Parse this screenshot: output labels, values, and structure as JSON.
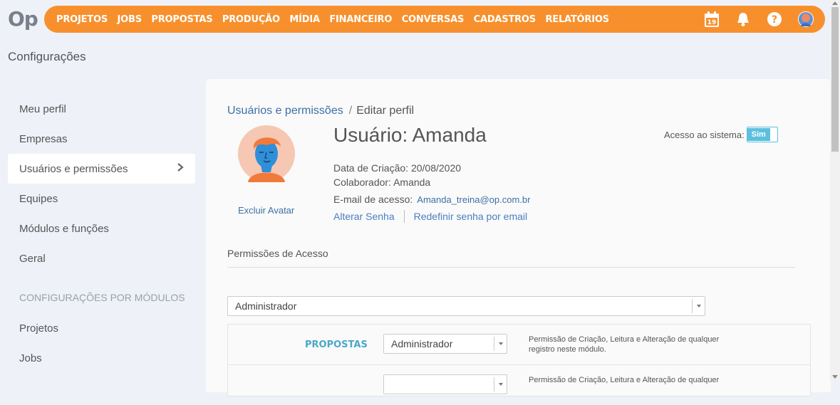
{
  "app": {
    "logo": "Op"
  },
  "topnav": [
    "PROJETOS",
    "JOBS",
    "PROPOSTAS",
    "PRODUÇÃO",
    "MÍDIA",
    "FINANCEIRO",
    "CONVERSAS",
    "CADASTROS",
    "RELATÓRIOS"
  ],
  "topicons": {
    "calendar_day": "19"
  },
  "page": {
    "title": "Configurações"
  },
  "sidebar": {
    "items": [
      {
        "label": "Meu perfil"
      },
      {
        "label": "Empresas"
      },
      {
        "label": "Usuários e permissões",
        "active": true
      },
      {
        "label": "Equipes"
      },
      {
        "label": "Módulos e funções"
      },
      {
        "label": "Geral"
      }
    ],
    "section_label": "CONFIGURAÇÕES POR MÓDULOS",
    "module_items": [
      {
        "label": "Projetos"
      },
      {
        "label": "Jobs"
      }
    ]
  },
  "breadcrumb": {
    "parent": "Usuários e permissões",
    "current": "Editar perfil"
  },
  "user": {
    "title": "Usuário: Amanda",
    "remove_avatar": "Excluir Avatar",
    "created_label": "Data de Criação:",
    "created_value": "20/08/2020",
    "collaborator_label": "Colaborador:",
    "collaborator_value": "Amanda",
    "email_label": "E-mail de acesso:",
    "email_value": "Amanda_treina@op.com.br",
    "change_password": "Alterar Senha",
    "reset_password": "Redefinir senha por email"
  },
  "access": {
    "label": "Acesso ao sistema:",
    "toggle": "Sim"
  },
  "permissions": {
    "heading": "Permissões de Acesso",
    "profile_select": "Administrador",
    "rows": [
      {
        "module": "PROPOSTAS",
        "select": "Administrador",
        "desc": "Permissão de Criação, Leitura e Alteração de qualquer registro neste módulo."
      },
      {
        "module": "",
        "select": "",
        "desc": "Permissão de Criação, Leitura e Alteração de qualquer"
      }
    ]
  },
  "colors": {
    "accent": "#f7902c",
    "link": "#3d6fa8",
    "toggle": "#5bc0de",
    "module_label": "#4aa8c8"
  }
}
